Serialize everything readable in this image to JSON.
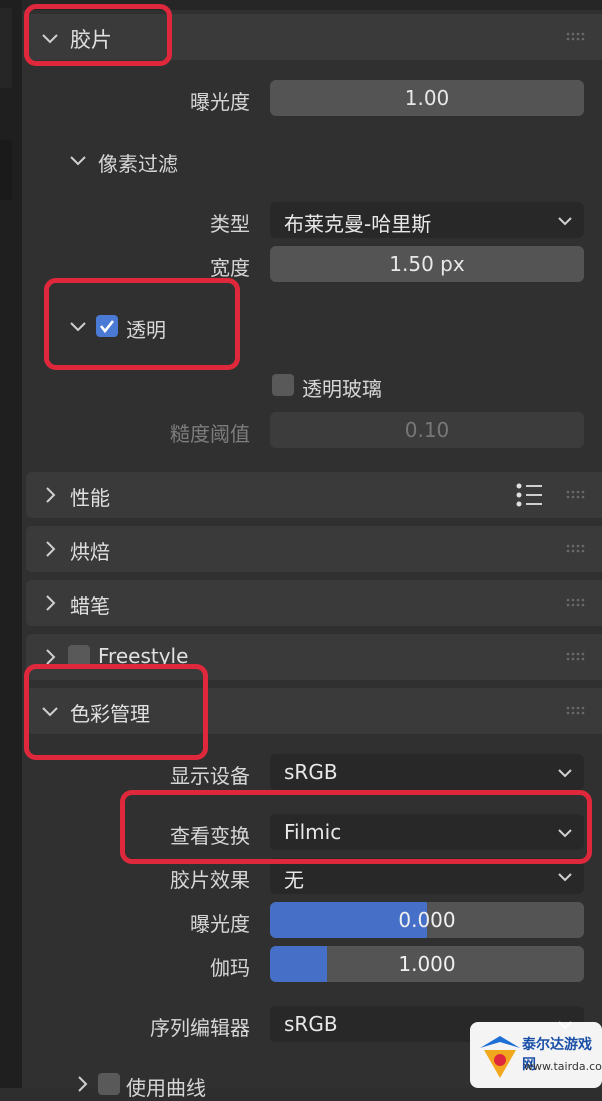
{
  "film": {
    "title": "胶片",
    "exposure_label": "曝光度",
    "exposure_value": "1.00",
    "pixel_filter": {
      "title": "像素过滤",
      "type_label": "类型",
      "type_value": "布莱克曼-哈里斯",
      "width_label": "宽度",
      "width_value": "1.50 px"
    },
    "transparent": {
      "label": "透明",
      "checked": true,
      "glass_label": "透明玻璃",
      "glass_checked": false,
      "roughness_label": "糙度阈值",
      "roughness_value": "0.10"
    }
  },
  "sections": [
    {
      "label": "性能",
      "expanded": false
    },
    {
      "label": "烘焙",
      "expanded": false
    },
    {
      "label": "蜡笔",
      "expanded": false
    },
    {
      "label": "Freestyle",
      "expanded": false
    }
  ],
  "color_management": {
    "title": "色彩管理",
    "display_device_label": "显示设备",
    "display_device_value": "sRGB",
    "view_transform_label": "查看变换",
    "view_transform_value": "Filmic",
    "look_label": "胶片效果",
    "look_value": "无",
    "exposure_label": "曝光度",
    "exposure_value": "0.000",
    "exposure_fill": 0.5,
    "gamma_label": "伽玛",
    "gamma_value": "1.000",
    "gamma_fill": 0.18,
    "sequencer_label": "序列编辑器",
    "sequencer_value": "sRGB",
    "curves_label": "使用曲线"
  },
  "watermark": {
    "text": "泰尔达游戏网",
    "url": "www.tairda.com"
  },
  "colors": {
    "accent_blue": "#4670c7",
    "highlight_red": "#e0283c"
  }
}
